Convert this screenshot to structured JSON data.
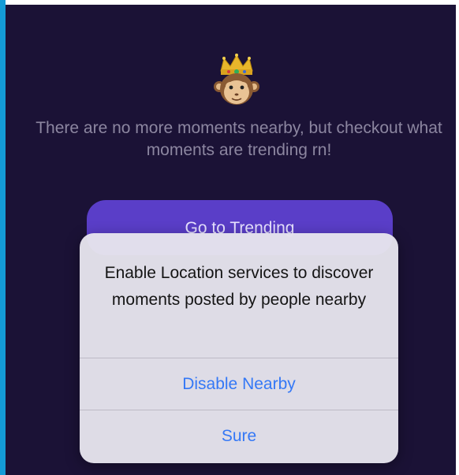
{
  "empty_state": {
    "icon": "crowned-monkey-emoji",
    "message": "There are no more moments nearby, but checkout what moments are trending rn!"
  },
  "trending_button": {
    "label": "Go to Trending"
  },
  "location_dialog": {
    "message": "Enable Location services to discover moments posted by people nearby",
    "actions": [
      {
        "label": "Disable Nearby"
      },
      {
        "label": "Sure"
      }
    ]
  },
  "colors": {
    "background": "#1b1236",
    "accent": "#5a3ec8",
    "action_blue": "#3478f6"
  }
}
